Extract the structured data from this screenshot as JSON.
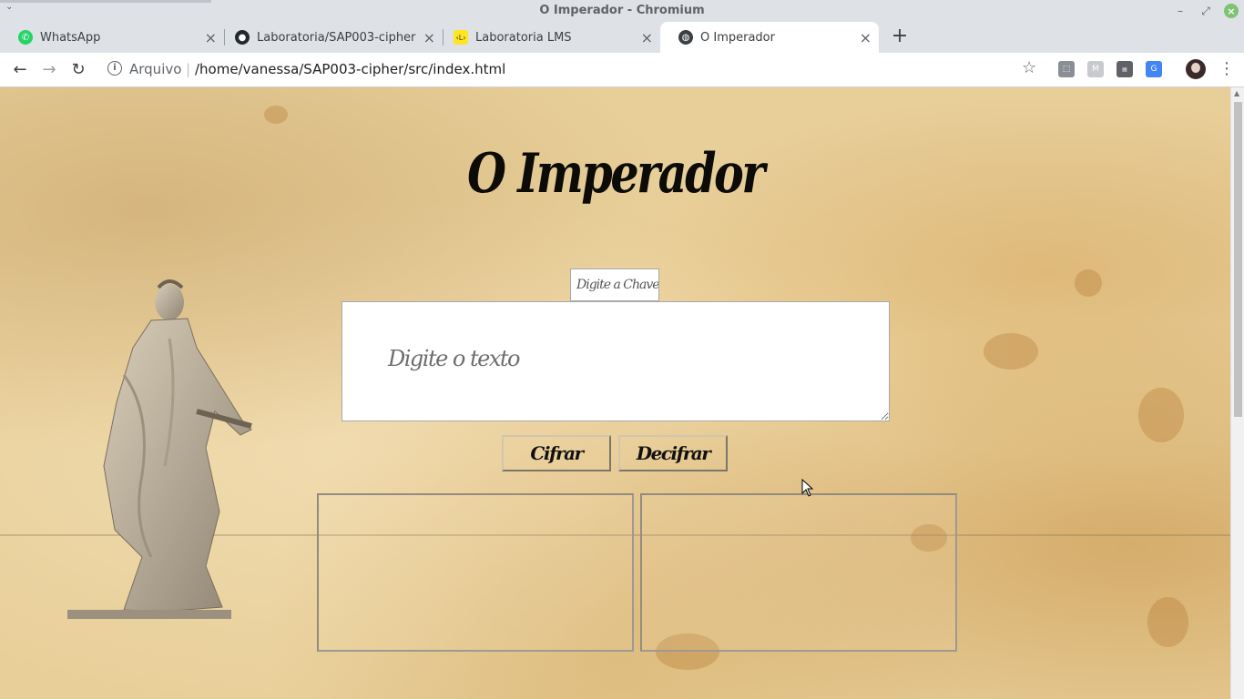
{
  "window": {
    "title": "O Imperador - Chromium"
  },
  "tabs": [
    {
      "label": "WhatsApp",
      "icon": "whatsapp-icon",
      "active": false
    },
    {
      "label": "Laboratoria/SAP003-cipher",
      "icon": "github-icon",
      "active": false
    },
    {
      "label": "Laboratoria LMS",
      "icon": "laboratoria-icon",
      "active": false
    },
    {
      "label": "O Imperador",
      "icon": "globe-icon",
      "active": true
    }
  ],
  "toolbar": {
    "scheme_label": "Arquivo",
    "url": "/home/vanessa/SAP003-cipher/src/index.html"
  },
  "page": {
    "title": "O Imperador",
    "key_placeholder": "Digite a Chave",
    "text_placeholder": "Digite o texto",
    "encrypt_label": "Cifrar",
    "decrypt_label": "Decifrar",
    "output_left": "",
    "output_right": ""
  },
  "colors": {
    "parchment": "#e8cf9a",
    "title_text": "#0c0b08",
    "chrome_frame": "#dee1e6"
  }
}
